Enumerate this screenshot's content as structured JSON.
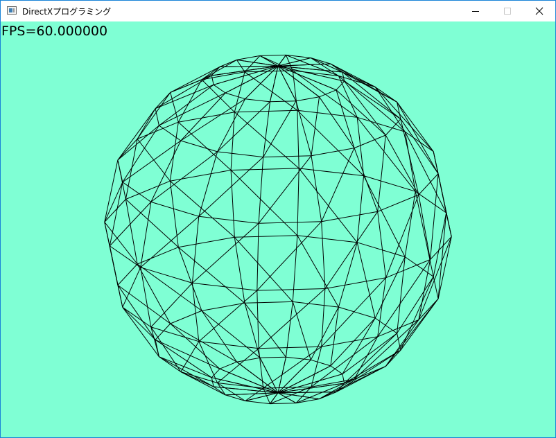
{
  "window": {
    "title": "DirectXプログラミング",
    "icon": "app-window-icon",
    "controls": [
      "minimize-icon",
      "maximize-icon",
      "close-icon"
    ]
  },
  "viewport": {
    "background_color": "#7fffd4",
    "fps_text": "FPS=60.000000",
    "mesh": {
      "shape": "sphere",
      "render_mode": "wireframe",
      "wire_color": "#000000"
    }
  }
}
